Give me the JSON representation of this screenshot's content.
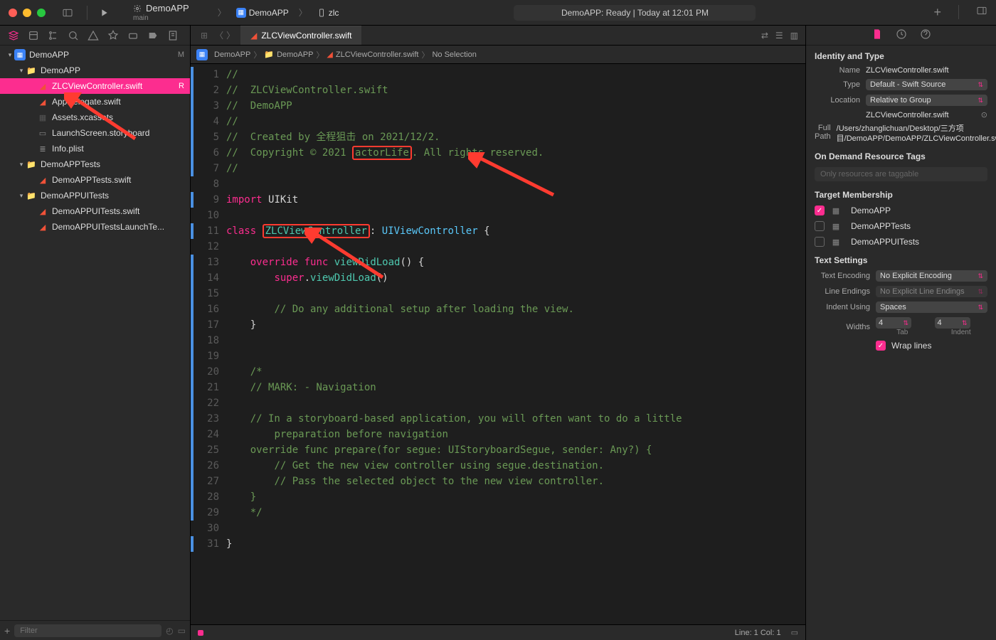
{
  "window": {
    "scheme_name": "DemoAPP",
    "scheme_branch": "main",
    "run_target_app": "DemoAPP",
    "run_target_device": "zlc",
    "activity_text": "DemoAPP: Ready | Today at 12:01 PM"
  },
  "navigator": {
    "project": "DemoAPP",
    "project_badge": "M",
    "groups": [
      {
        "name": "DemoAPP",
        "items": [
          {
            "name": "ZLCViewController.swift",
            "icon": "swift",
            "badge": "R",
            "selected": true
          },
          {
            "name": "AppDelegate.swift",
            "icon": "swift"
          },
          {
            "name": "Assets.xcassets",
            "icon": "assets"
          },
          {
            "name": "LaunchScreen.storyboard",
            "icon": "storyboard"
          },
          {
            "name": "Info.plist",
            "icon": "plist"
          }
        ]
      },
      {
        "name": "DemoAPPTests",
        "items": [
          {
            "name": "DemoAPPTests.swift",
            "icon": "swift"
          }
        ]
      },
      {
        "name": "DemoAPPUITests",
        "items": [
          {
            "name": "DemoAPPUITests.swift",
            "icon": "swift"
          },
          {
            "name": "DemoAPPUITestsLaunchTe...",
            "icon": "swift"
          }
        ]
      }
    ],
    "filter_placeholder": "Filter"
  },
  "editor": {
    "tab_name": "ZLCViewController.swift",
    "jump_bar": [
      "DemoAPP",
      "DemoAPP",
      "ZLCViewController.swift",
      "No Selection"
    ],
    "status": "Line: 1  Col: 1",
    "code_lines": [
      {
        "n": 1,
        "m": true,
        "html": "<span class='cm-comment'>//</span>"
      },
      {
        "n": 2,
        "m": true,
        "html": "<span class='cm-comment'>//  ZLCViewController.swift</span>"
      },
      {
        "n": 3,
        "m": true,
        "html": "<span class='cm-comment'>//  DemoAPP</span>"
      },
      {
        "n": 4,
        "m": true,
        "html": "<span class='cm-comment'>//</span>"
      },
      {
        "n": 5,
        "m": true,
        "html": "<span class='cm-comment'>//  Created by 全程狙击 on 2021/12/2.</span>"
      },
      {
        "n": 6,
        "m": true,
        "html": "<span class='cm-comment'>//  Copyright © 2021 </span><span class='highlight-box cm-comment'>actorLife</span><span class='cm-comment'>. All rights reserved.</span>"
      },
      {
        "n": 7,
        "m": true,
        "html": "<span class='cm-comment'>//</span>"
      },
      {
        "n": 8,
        "m": false,
        "html": ""
      },
      {
        "n": 9,
        "m": true,
        "html": "<span class='cm-keyword'>import</span> <span class='cm-ident'>UIKit</span>"
      },
      {
        "n": 10,
        "m": false,
        "html": ""
      },
      {
        "n": 11,
        "m": true,
        "html": "<span class='cm-keyword'>class</span> <span class='highlight-box cm-prop'>ZLCViewController</span><span class='cm-ident'>:</span> <span class='cm-type'>UIViewController</span> <span class='cm-ident'>{</span>"
      },
      {
        "n": 12,
        "m": false,
        "html": ""
      },
      {
        "n": 13,
        "m": true,
        "html": "    <span class='cm-keyword'>override</span> <span class='cm-keyword'>func</span> <span class='cm-func'>viewDidLoad</span><span class='cm-ident'>() {</span>"
      },
      {
        "n": 14,
        "m": true,
        "html": "        <span class='cm-keyword'>super</span><span class='cm-ident'>.</span><span class='cm-prop'>viewDidLoad</span><span class='cm-ident'>()</span>"
      },
      {
        "n": 15,
        "m": true,
        "html": ""
      },
      {
        "n": 16,
        "m": true,
        "html": "        <span class='cm-comment'>// Do any additional setup after loading the view.</span>"
      },
      {
        "n": 17,
        "m": true,
        "html": "    <span class='cm-ident'>}</span>"
      },
      {
        "n": 18,
        "m": true,
        "html": "    "
      },
      {
        "n": 19,
        "m": true,
        "html": ""
      },
      {
        "n": 20,
        "m": true,
        "html": "    <span class='cm-comment'>/*</span>"
      },
      {
        "n": 21,
        "m": true,
        "html": "    <span class='cm-comment'>// MARK: - Navigation</span>"
      },
      {
        "n": 22,
        "m": true,
        "html": ""
      },
      {
        "n": 23,
        "m": true,
        "html": "    <span class='cm-comment'>// In a storyboard-based application, you will often want to do a little</span>"
      },
      {
        "n": "",
        "m": true,
        "html": "        <span class='cm-comment'>preparation before navigation</span>"
      },
      {
        "n": 24,
        "m": true,
        "html": "    <span class='cm-comment'>override func prepare(for segue: UIStoryboardSegue, sender: Any?) {</span>"
      },
      {
        "n": 25,
        "m": true,
        "html": "        <span class='cm-comment'>// Get the new view controller using segue.destination.</span>"
      },
      {
        "n": 26,
        "m": true,
        "html": "        <span class='cm-comment'>// Pass the selected object to the new view controller.</span>"
      },
      {
        "n": 27,
        "m": true,
        "html": "    <span class='cm-comment'>}</span>"
      },
      {
        "n": 28,
        "m": true,
        "html": "    <span class='cm-comment'>*/</span>"
      },
      {
        "n": 29,
        "m": false,
        "html": ""
      },
      {
        "n": 30,
        "m": true,
        "html": "<span class='cm-ident'>}</span>"
      },
      {
        "n": 31,
        "m": false,
        "html": ""
      }
    ]
  },
  "inspector": {
    "identity_header": "Identity and Type",
    "name_label": "Name",
    "name_value": "ZLCViewController.swift",
    "type_label": "Type",
    "type_value": "Default - Swift Source",
    "location_label": "Location",
    "location_value": "Relative to Group",
    "location_file": "ZLCViewController.swift",
    "fullpath_label": "Full Path",
    "fullpath_value": "/Users/zhanglichuan/Desktop/三方项目/DemoAPP/DemoAPP/ZLCViewController.swift",
    "ondemand_header": "On Demand Resource Tags",
    "ondemand_placeholder": "Only resources are taggable",
    "target_header": "Target Membership",
    "targets": [
      {
        "name": "DemoAPP",
        "checked": true,
        "icon": "app"
      },
      {
        "name": "DemoAPPTests",
        "checked": false,
        "icon": "test"
      },
      {
        "name": "DemoAPPUITests",
        "checked": false,
        "icon": "uitest"
      }
    ],
    "text_header": "Text Settings",
    "encoding_label": "Text Encoding",
    "encoding_value": "No Explicit Encoding",
    "endings_label": "Line Endings",
    "endings_value": "No Explicit Line Endings",
    "indent_label": "Indent Using",
    "indent_value": "Spaces",
    "widths_label": "Widths",
    "tab_width": "4",
    "indent_width": "4",
    "tab_sublabel": "Tab",
    "indent_sublabel": "Indent",
    "wrap_label": "Wrap lines"
  }
}
